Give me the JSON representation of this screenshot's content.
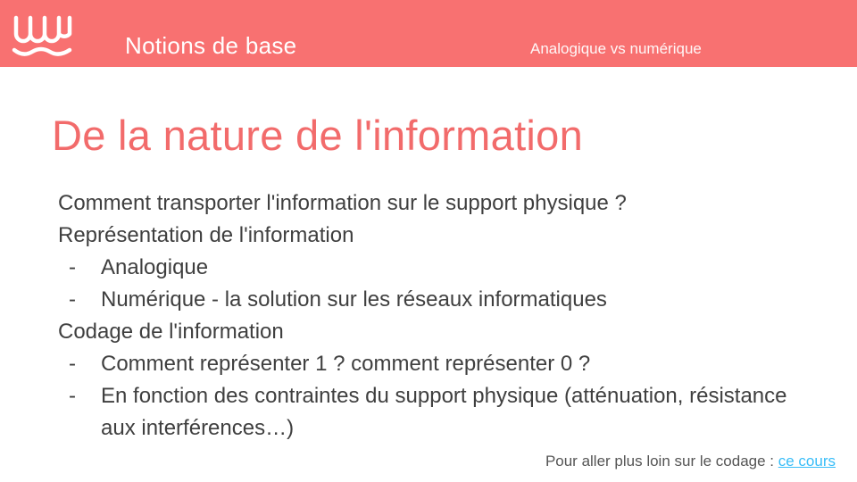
{
  "header": {
    "section_title": "Notions de base",
    "section_subtitle": "Analogique vs numérique",
    "logo_icon": "wave-logo-icon",
    "background_color": "#f87171"
  },
  "slide": {
    "title": "De la nature de l'information",
    "title_color": "#f26b6b",
    "items": [
      {
        "type": "line",
        "text": "Comment transporter l'information sur le support physique ?"
      },
      {
        "type": "line",
        "text": "Représentation de l'information"
      },
      {
        "type": "bullet",
        "text": "Analogique"
      },
      {
        "type": "bullet",
        "text": "Numérique - la solution sur les réseaux informatiques"
      },
      {
        "type": "line",
        "text": "Codage de l'information"
      },
      {
        "type": "bullet",
        "text": "Comment représenter 1 ? comment représenter 0 ?"
      },
      {
        "type": "bullet",
        "text": "En fonction des contraintes du support physique (atténuation, résistance aux interférences…)"
      }
    ],
    "bullet_marker": "-"
  },
  "footer": {
    "text": "Pour aller plus loin sur le codage : ",
    "link_text": "ce cours",
    "link_color": "#38bdf8"
  }
}
